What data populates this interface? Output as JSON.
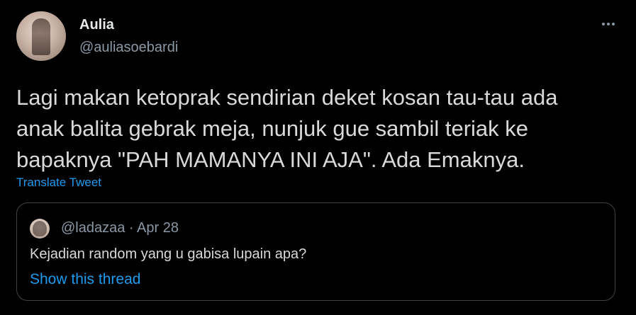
{
  "tweet": {
    "author_name": "Aulia",
    "author_handle": "@auliasoebardi",
    "text": "Lagi makan ketoprak sendirian deket kosan tau-tau ada\nanak balita gebrak meja, nunjuk gue sambil teriak ke\nbapaknya \"PAH MAMANYA INI AJA\". Ada Emaknya.",
    "translate_label": "Translate Tweet"
  },
  "quoted_tweet": {
    "meta": "@ladazaa · Apr 28",
    "text": "Kejadian random yang u gabisa lupain apa?",
    "show_thread_label": "Show this thread"
  },
  "icons": {
    "more": "more-options-icon"
  },
  "colors": {
    "background": "#000000",
    "text": "#d9d9d9",
    "muted": "#8b98a5",
    "link": "#1d9bf0",
    "border": "#3d4349"
  }
}
